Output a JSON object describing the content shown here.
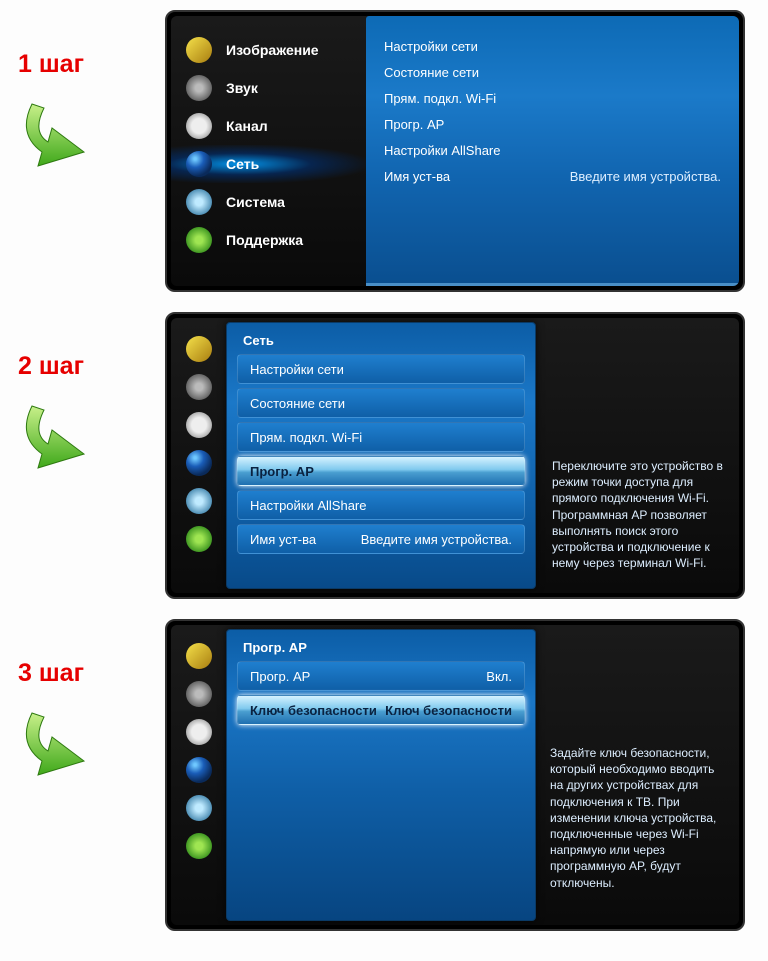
{
  "colors": {
    "accent_red": "#e60000",
    "panel_blue": "#1670bd"
  },
  "steps": {
    "s1": "1 шаг",
    "s2": "2 шаг",
    "s3": "3 шаг"
  },
  "main_menu": [
    {
      "icon": "picture-icon",
      "label": "Изображение"
    },
    {
      "icon": "sound-icon",
      "label": "Звук"
    },
    {
      "icon": "channel-icon",
      "label": "Канал"
    },
    {
      "icon": "network-icon",
      "label": "Сеть"
    },
    {
      "icon": "system-icon",
      "label": "Система"
    },
    {
      "icon": "support-icon",
      "label": "Поддержка"
    }
  ],
  "step1_submenu": {
    "items": [
      "Настройки сети",
      "Состояние сети",
      "Прям. подкл. Wi-Fi",
      "Прогр. AP",
      "Настройки AllShare"
    ],
    "device_name_label": "Имя уст-ва",
    "device_name_hint": "Введите имя устройства."
  },
  "step2": {
    "title": "Сеть",
    "options": [
      "Настройки сети",
      "Состояние сети",
      "Прям. подкл. Wi-Fi",
      "Прогр. AP",
      "Настройки AllShare"
    ],
    "dev_label": "Имя уст-ва",
    "dev_hint": "Введите имя устройства.",
    "desc": "Переключите это устройство в режим точки доступа для прямого подключения Wi-Fi. Программная AP позволяет выполнять поиск этого устройства и подключение к нему через терминал Wi-Fi."
  },
  "step3": {
    "title": "Прогр. AP",
    "row1_label": "Прогр. AP",
    "row1_value": "Вкл.",
    "row2_label": "Ключ безопасности",
    "row2_value": "Ключ безопасности",
    "desc": "Задайте ключ безопасности, который необходимо вводить на других устройствах для подключения к ТВ. При изменении ключа устройства, подключенные через Wi-Fi напрямую или через программную AP, будут отключены."
  }
}
